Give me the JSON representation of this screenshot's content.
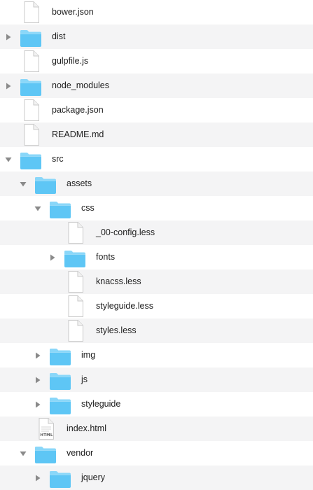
{
  "tree": {
    "items": [
      {
        "name": "bower.json",
        "type": "file",
        "level": 0,
        "expanded": null
      },
      {
        "name": "dist",
        "type": "folder",
        "level": 0,
        "expanded": false
      },
      {
        "name": "gulpfile.js",
        "type": "file",
        "level": 0,
        "expanded": null
      },
      {
        "name": "node_modules",
        "type": "folder",
        "level": 0,
        "expanded": false
      },
      {
        "name": "package.json",
        "type": "file",
        "level": 0,
        "expanded": null
      },
      {
        "name": "README.md",
        "type": "file",
        "level": 0,
        "expanded": null
      },
      {
        "name": "src",
        "type": "folder",
        "level": 0,
        "expanded": true
      },
      {
        "name": "assets",
        "type": "folder",
        "level": 1,
        "expanded": true
      },
      {
        "name": "css",
        "type": "folder",
        "level": 2,
        "expanded": true
      },
      {
        "name": "_00-config.less",
        "type": "file",
        "level": 3,
        "expanded": null
      },
      {
        "name": "fonts",
        "type": "folder",
        "level": 3,
        "expanded": false
      },
      {
        "name": "knacss.less",
        "type": "file",
        "level": 3,
        "expanded": null
      },
      {
        "name": "styleguide.less",
        "type": "file",
        "level": 3,
        "expanded": null
      },
      {
        "name": "styles.less",
        "type": "file",
        "level": 3,
        "expanded": null
      },
      {
        "name": "img",
        "type": "folder",
        "level": 2,
        "expanded": false
      },
      {
        "name": "js",
        "type": "folder",
        "level": 2,
        "expanded": false
      },
      {
        "name": "styleguide",
        "type": "folder",
        "level": 2,
        "expanded": false
      },
      {
        "name": "index.html",
        "type": "html",
        "level": 1,
        "expanded": null,
        "icon_badge": "HTML"
      },
      {
        "name": "vendor",
        "type": "folder",
        "level": 1,
        "expanded": true
      },
      {
        "name": "jquery",
        "type": "folder",
        "level": 2,
        "expanded": false
      }
    ]
  },
  "colors": {
    "stripe": "#f4f4f5",
    "folder_body": "#5ec6f5",
    "folder_tab": "#8ad7f9",
    "disclosure": "#8a8a8a",
    "text": "#1e1e1e"
  },
  "icons": {
    "folder": "folder-icon",
    "file": "document-icon",
    "html": "html-document-icon",
    "expanded": "disclosure-triangle-down-icon",
    "collapsed": "disclosure-triangle-right-icon"
  }
}
